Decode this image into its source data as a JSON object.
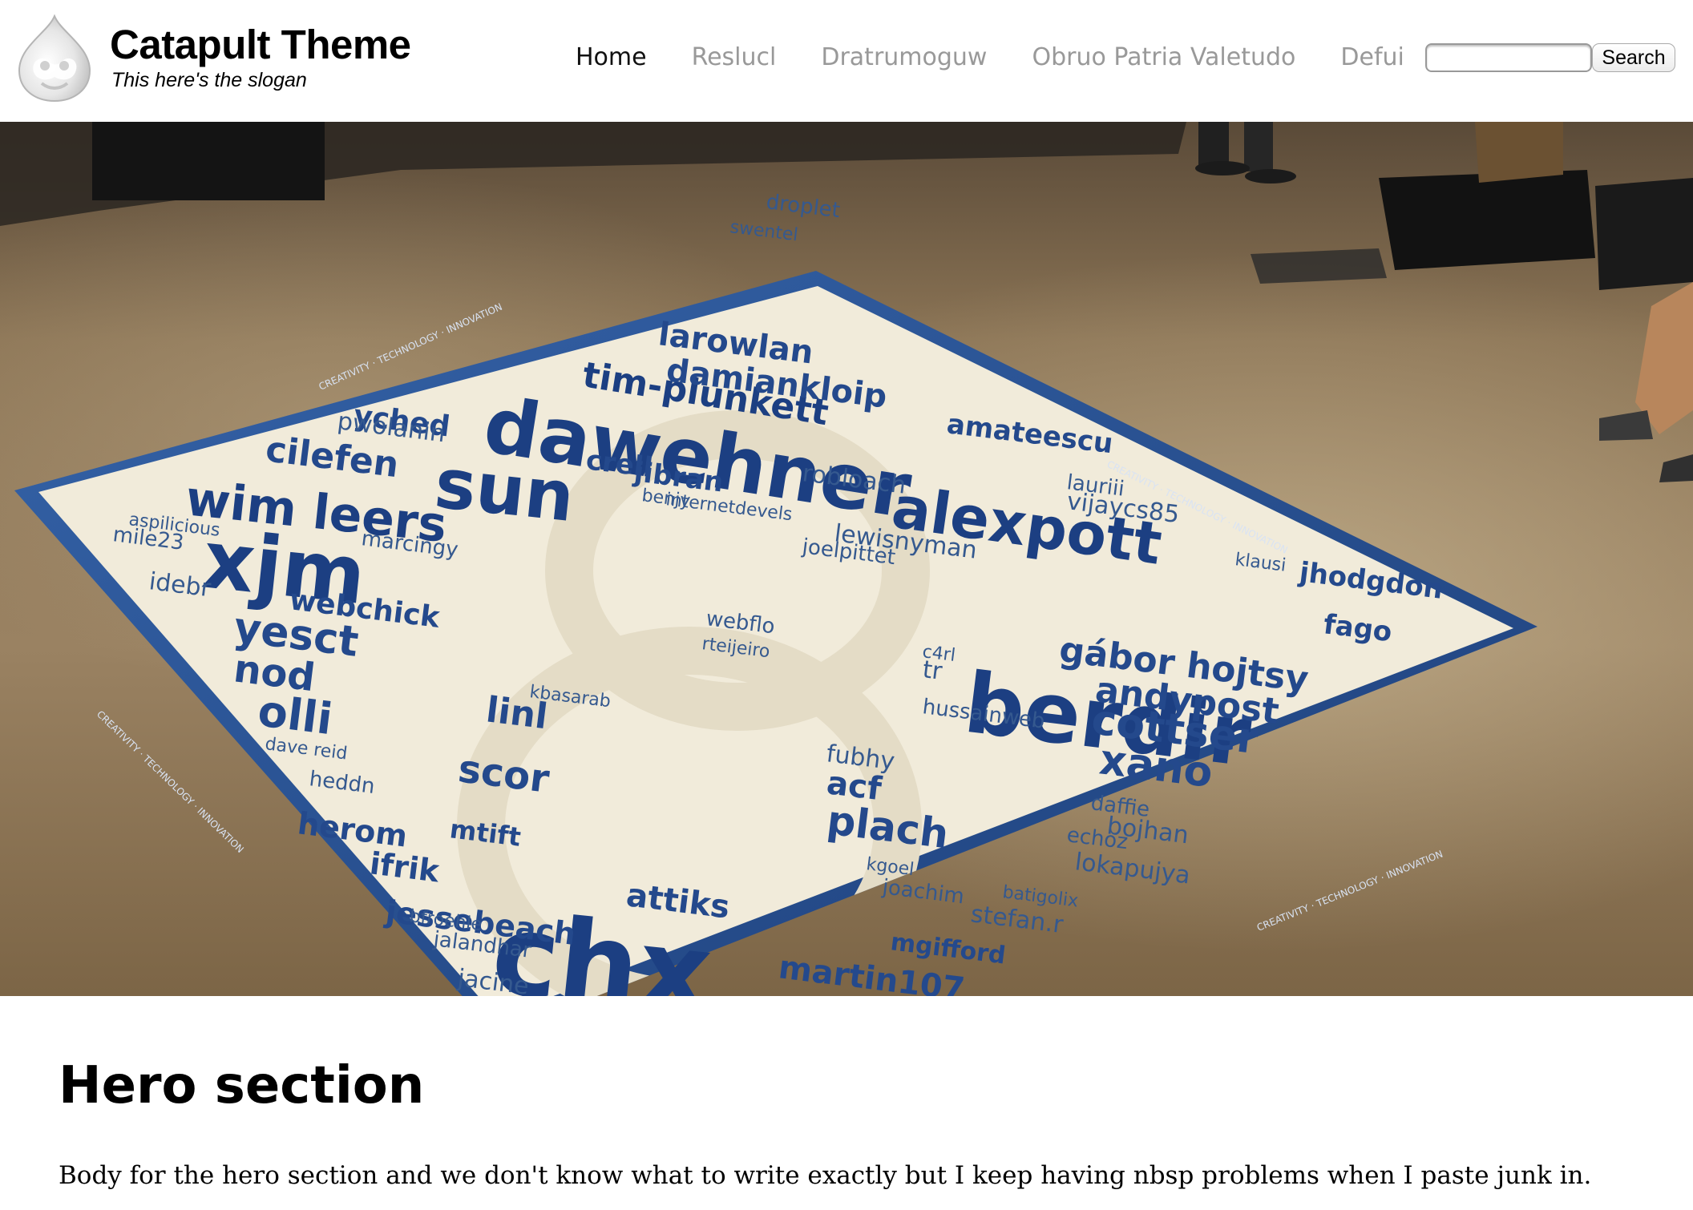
{
  "header": {
    "site_name": "Catapult Theme",
    "slogan": "This here's the slogan",
    "logo_icon": "drupal-drop-icon"
  },
  "nav": {
    "items": [
      {
        "label": "Home",
        "active": true
      },
      {
        "label": "Reslucl",
        "active": false
      },
      {
        "label": "Dratrumoguw",
        "active": false
      },
      {
        "label": "Obruo Patria Valetudo",
        "active": false
      },
      {
        "label": "Defui",
        "active": false
      }
    ]
  },
  "search": {
    "value": "",
    "button_label": "Search"
  },
  "hero_image": {
    "wordcloud": {
      "large": [
        "dawehner",
        "berdir",
        "alexpott",
        "chx",
        "xjm",
        "sun",
        "wim leers",
        "tim-plunkett"
      ],
      "medium": [
        "yesct",
        "nod",
        "olli",
        "larowlan",
        "damiankloip",
        "amateescu",
        "cottser",
        "xano",
        "andypost",
        "gábor hojtsy",
        "jhodgdon",
        "fago",
        "plach",
        "acf",
        "scor",
        "linl",
        "ifrik",
        "jessebeach",
        "herom",
        "mtift",
        "attiks",
        "martin107",
        "mgifford",
        "webchick",
        "cilefen",
        "yched",
        "crell",
        "jibran"
      ],
      "small": [
        "swentel",
        "droplet",
        "pwolanin",
        "aspilicious",
        "mile23",
        "idebr",
        "dave reid",
        "heddn",
        "robloach",
        "benjy",
        "lauriii",
        "vijaycs85",
        "klausi",
        "joelpittet",
        "fubhy",
        "kgoel",
        "joachim",
        "stefan.r",
        "batigolix",
        "daffie",
        "bojhan",
        "rteijeiro",
        "webflo",
        "tr",
        "c4rl",
        "echoz",
        "lokapujya",
        "bfroehle",
        "jalandhar",
        "jacine",
        "kbasarab",
        "marcingy",
        "lewisnyman",
        "internetdevels",
        "hussainweb"
      ]
    },
    "border_text": "CREATIVITY · TECHNOLOGY · INNOVATION"
  },
  "hero": {
    "title": "Hero section",
    "body": "Body for the hero section and we don't know what to write exactly but I keep having nbsp problems when I paste junk in."
  },
  "colors": {
    "nav_active": "#111111",
    "nav_inactive": "#999999",
    "floor": "#8a7152",
    "poster_blue": "#234a8c",
    "poster_paper": "#f1ebda"
  }
}
